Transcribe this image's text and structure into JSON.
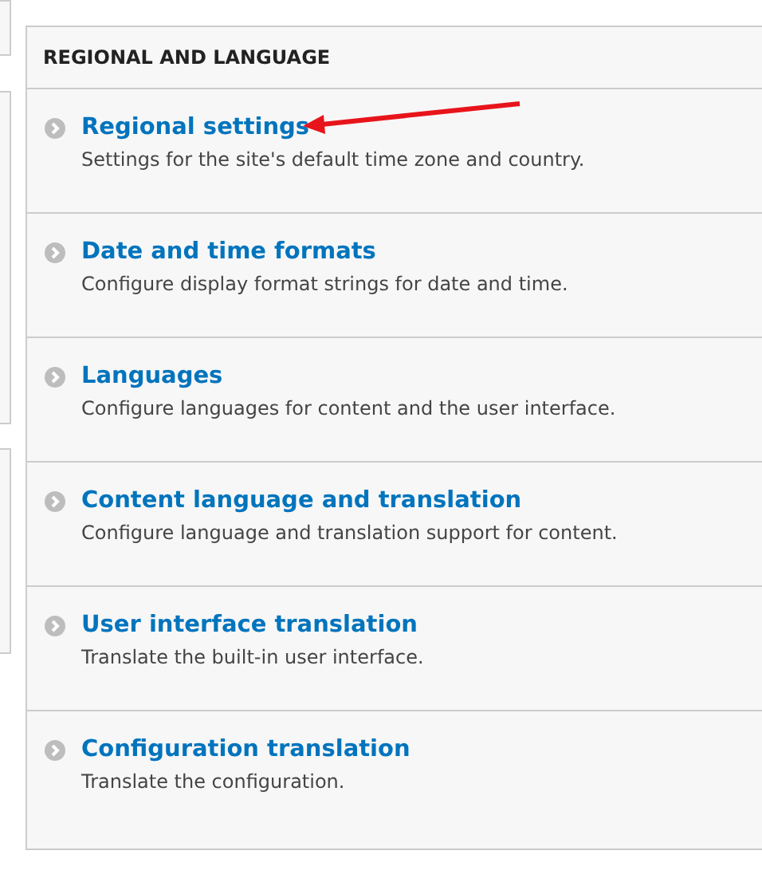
{
  "panel": {
    "title": "REGIONAL AND LANGUAGE",
    "items": [
      {
        "title": "Regional settings",
        "description": "Settings for the site's default time zone and country."
      },
      {
        "title": "Date and time formats",
        "description": "Configure display format strings for date and time."
      },
      {
        "title": "Languages",
        "description": "Configure languages for content and the user interface."
      },
      {
        "title": "Content language and translation",
        "description": "Configure language and translation support for content."
      },
      {
        "title": "User interface translation",
        "description": "Translate the built-in user interface."
      },
      {
        "title": "Configuration translation",
        "description": "Translate the configuration."
      }
    ]
  }
}
